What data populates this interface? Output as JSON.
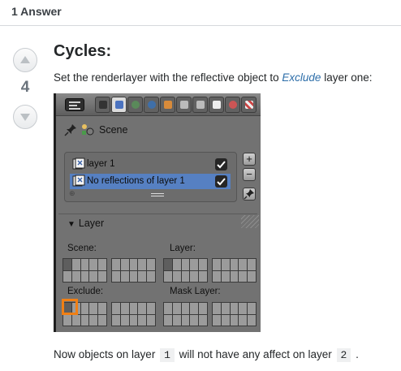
{
  "header": {
    "answer_count": "1 Answer"
  },
  "vote": {
    "score": "4"
  },
  "post": {
    "title": "Cycles:",
    "intro_before": "Set the renderlayer with the reflective object to ",
    "intro_link": "Exclude",
    "intro_after": " layer one:",
    "footer_1": "Now objects on layer ",
    "footer_code_1": "1",
    "footer_2": " will not have any affect on layer ",
    "footer_code_2": "2",
    "footer_3": " ."
  },
  "blender": {
    "scene_label": "Scene",
    "render_layers": [
      {
        "label": "layer 1",
        "selected": false,
        "checked": true
      },
      {
        "label": "No reflections of layer 1",
        "selected": true,
        "checked": true
      }
    ],
    "panel_title": "Layer",
    "labels": {
      "scene": "Scene:",
      "layer": "Layer:",
      "exclude": "Exclude:",
      "mask_layer": "Mask Layer:"
    },
    "side_buttons": {
      "plus": "+",
      "minus": "−"
    },
    "highlight_color": "#f07f14",
    "selected_row_color": "#5680c2"
  }
}
